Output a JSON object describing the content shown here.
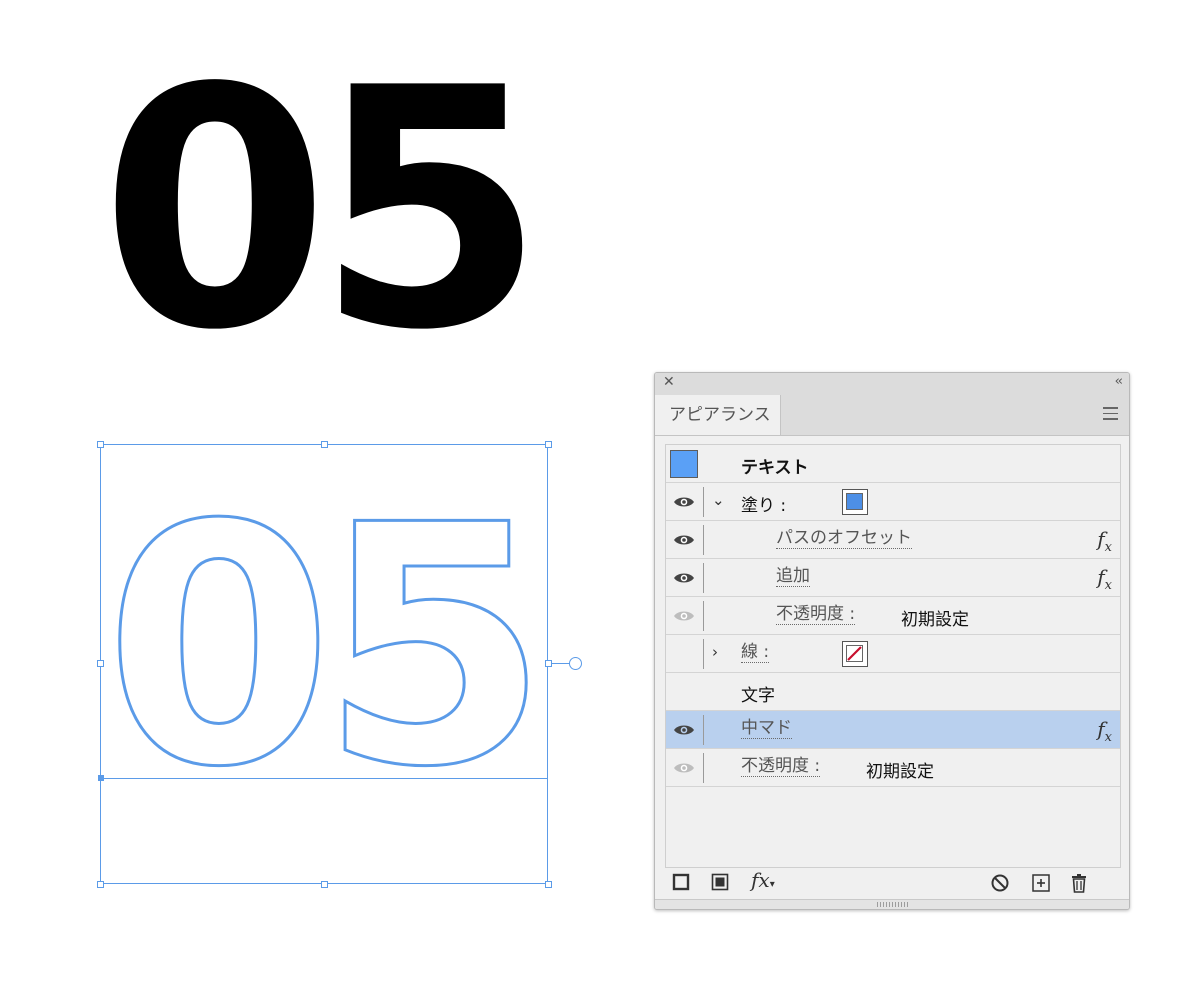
{
  "artwork": {
    "big_number": "05",
    "outline_number": "05"
  },
  "panel": {
    "tab_title": "アピアランス",
    "close_glyph": "✕",
    "collapse_glyph": "‹‹",
    "rows": {
      "text_object": {
        "label": "テキスト",
        "swatch_color": "#5aa0f6"
      },
      "fill": {
        "label": "塗り :",
        "swatch_color": "#4d8fe6"
      },
      "offset_path": {
        "label": "パスのオフセット",
        "icon": "fx-icon"
      },
      "add": {
        "label": "追加",
        "icon": "fx-icon"
      },
      "fill_opacity": {
        "label": "不透明度 :",
        "value": "初期設定"
      },
      "stroke": {
        "label": "線 :",
        "swatch": "none"
      },
      "characters": {
        "label": "文字"
      },
      "naka_mado": {
        "label": "中マド",
        "icon": "fx-icon"
      },
      "opacity": {
        "label": "不透明度 :",
        "value": "初期設定"
      }
    },
    "footer": {
      "add_new_stroke": "add-stroke-icon",
      "add_new_fill": "add-fill-icon",
      "add_effect_label": "fx",
      "clear_appearance": "clear-icon",
      "duplicate_item": "duplicate-icon",
      "delete_item": "trash-icon"
    }
  },
  "colors": {
    "selection_blue": "#5b9be8",
    "selected_row": "#b9d0ee",
    "stroke_none_red": "#c8102e"
  }
}
